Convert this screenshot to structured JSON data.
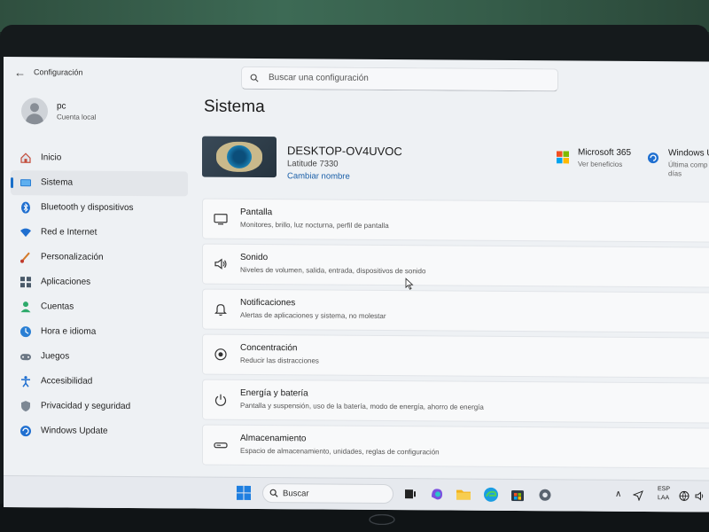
{
  "window": {
    "app_title": "Configuración",
    "search_placeholder": "Buscar una configuración"
  },
  "user": {
    "name": "pc",
    "account_type": "Cuenta local"
  },
  "sidebar": {
    "selected": "Sistema",
    "items": [
      {
        "label": "Inicio",
        "icon": "home-icon"
      },
      {
        "label": "Sistema",
        "icon": "monitor-icon"
      },
      {
        "label": "Bluetooth y dispositivos",
        "icon": "bluetooth-icon"
      },
      {
        "label": "Red e Internet",
        "icon": "wifi-icon"
      },
      {
        "label": "Personalización",
        "icon": "brush-icon"
      },
      {
        "label": "Aplicaciones",
        "icon": "apps-icon"
      },
      {
        "label": "Cuentas",
        "icon": "person-icon"
      },
      {
        "label": "Hora e idioma",
        "icon": "globe-clock-icon"
      },
      {
        "label": "Juegos",
        "icon": "gamepad-icon"
      },
      {
        "label": "Accesibilidad",
        "icon": "accessibility-icon"
      },
      {
        "label": "Privacidad y seguridad",
        "icon": "shield-icon"
      },
      {
        "label": "Windows Update",
        "icon": "update-icon"
      }
    ]
  },
  "main": {
    "title": "Sistema",
    "device": {
      "name": "DESKTOP-OV4UVOC",
      "model": "Latitude 7330",
      "rename_label": "Cambiar nombre"
    },
    "promos": [
      {
        "title": "Microsoft 365",
        "subtitle": "Ver beneficios",
        "icon": "microsoft-logo-icon"
      },
      {
        "title": "Windows U",
        "subtitle": "Última comp",
        "subtitle2": "días",
        "icon": "windows-update-icon"
      }
    ],
    "cards": [
      {
        "title": "Pantalla",
        "subtitle": "Monitores, brillo, luz nocturna, perfil de pantalla",
        "icon": "display-icon"
      },
      {
        "title": "Sonido",
        "subtitle": "Niveles de volumen, salida, entrada, dispositivos de sonido",
        "icon": "speaker-icon"
      },
      {
        "title": "Notificaciones",
        "subtitle": "Alertas de aplicaciones y sistema, no molestar",
        "icon": "bell-icon"
      },
      {
        "title": "Concentración",
        "subtitle": "Reducir las distracciones",
        "icon": "focus-icon"
      },
      {
        "title": "Energía y batería",
        "subtitle": "Pantalla y suspensión, uso de la batería, modo de energía, ahorro de energía",
        "icon": "power-icon"
      },
      {
        "title": "Almacenamiento",
        "subtitle": "Espacio de almacenamiento, unidades, reglas de configuración",
        "icon": "storage-icon"
      }
    ]
  },
  "taskbar": {
    "search_label": "Buscar",
    "language_top": "ESP",
    "language_bottom": "LAA",
    "icons": [
      "windows-start-icon",
      "task-view-icon",
      "copilot-icon",
      "file-explorer-icon",
      "edge-icon",
      "store-icon",
      "settings-icon"
    ]
  },
  "colors": {
    "accent": "#1a6fc9",
    "link": "#1a5fa8",
    "window_bg": "#eef1f4",
    "card_bg": "#f8f9fa"
  }
}
